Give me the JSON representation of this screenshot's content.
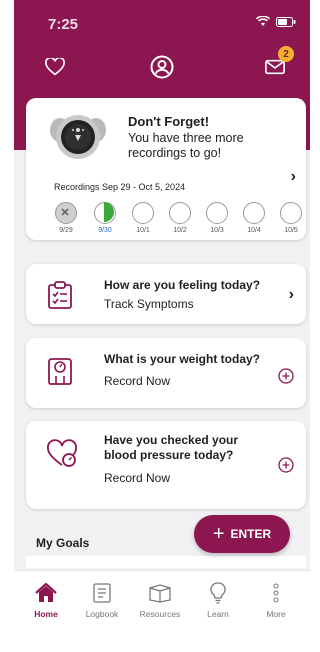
{
  "status": {
    "time": "7:25"
  },
  "topnav": {
    "notification_count": "2"
  },
  "reminder": {
    "title": "Don't Forget!",
    "subtitle": "You have three more recordings to go!",
    "range": "Recordings Sep 29 - Oct 5, 2024",
    "days": [
      {
        "label": "9/29",
        "state": "missed"
      },
      {
        "label": "9/30",
        "state": "today"
      },
      {
        "label": "10/1",
        "state": "upcoming"
      },
      {
        "label": "10/2",
        "state": "upcoming"
      },
      {
        "label": "10/3",
        "state": "upcoming"
      },
      {
        "label": "10/4",
        "state": "upcoming"
      },
      {
        "label": "10/5",
        "state": "upcoming"
      }
    ]
  },
  "symptoms": {
    "title": "How are you feeling today?",
    "action": "Track Symptoms"
  },
  "weight": {
    "title": "What is your weight today?",
    "action": "Record Now"
  },
  "blood_pressure": {
    "title": "Have you checked your blood pressure today?",
    "action": "Record Now"
  },
  "goals": {
    "title": "My Goals"
  },
  "enter_button": {
    "label": "ENTER"
  },
  "tabs": [
    {
      "label": "Home",
      "icon": "home-icon",
      "active": true
    },
    {
      "label": "Logbook",
      "icon": "logbook-icon"
    },
    {
      "label": "Resources",
      "icon": "resources-icon"
    },
    {
      "label": "Learn",
      "icon": "lightbulb-icon"
    },
    {
      "label": "More",
      "icon": "more-icon"
    }
  ],
  "colors": {
    "brand": "#8c1750",
    "badge": "#f4b22b",
    "today_progress": "#3aa83a"
  }
}
